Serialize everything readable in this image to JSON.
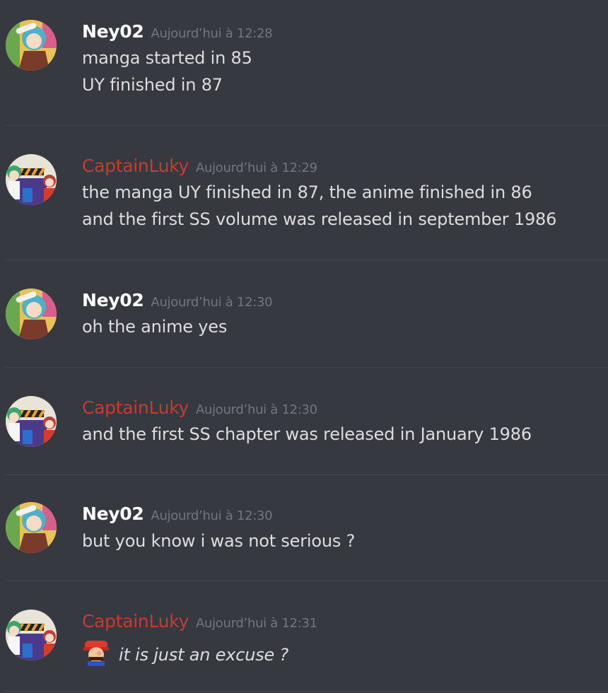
{
  "messages": [
    {
      "author": "Ney02",
      "timestamp": "Aujourd’hui à 12:28",
      "lines": [
        "manga started in 85",
        "UY finished in 87"
      ]
    },
    {
      "author": "CaptainLuky",
      "timestamp": "Aujourd’hui à 12:29",
      "lines": [
        "the manga UY finished in 87, the anime finished in 86",
        "and the first SS volume was released in september 1986"
      ]
    },
    {
      "author": "Ney02",
      "timestamp": "Aujourd’hui à 12:30",
      "lines": [
        "oh the anime yes"
      ]
    },
    {
      "author": "CaptainLuky",
      "timestamp": "Aujourd’hui à 12:30",
      "lines": [
        "and the first SS chapter was released in January 1986"
      ]
    },
    {
      "author": "Ney02",
      "timestamp": "Aujourd’hui à 12:30",
      "lines": [
        "but you know i was not serious ?"
      ]
    },
    {
      "author": "CaptainLuky",
      "timestamp": "Aujourd’hui à 12:31",
      "emoji": "mario-emoji",
      "lines": [
        "it is just an excuse ?"
      ]
    }
  ],
  "colors": {
    "background": "#36393f",
    "author_ney": "#ffffff",
    "author_luky": "#c23d36",
    "timestamp": "#72767d",
    "text": "#dcddde",
    "divider": "#44474d"
  }
}
